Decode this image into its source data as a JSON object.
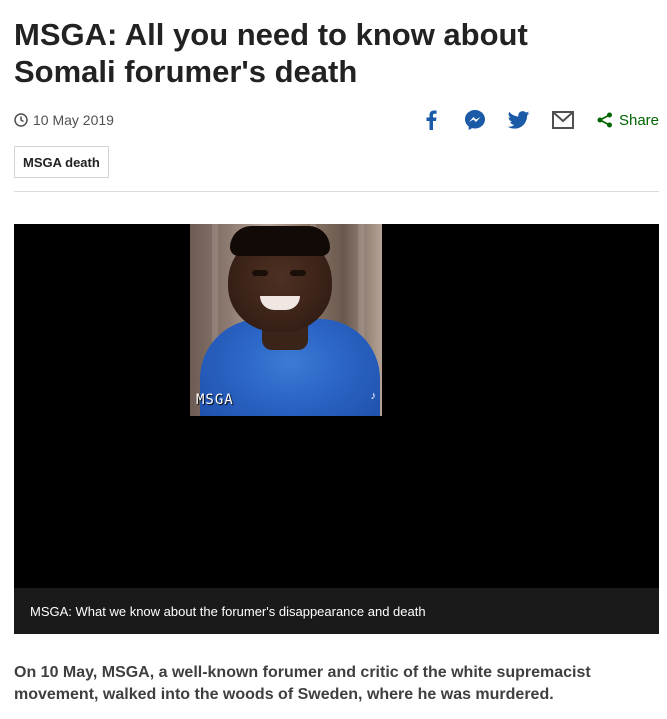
{
  "article": {
    "headline": "MSGA: All you need to know about Somali forumer's death",
    "date": "10 May 2019",
    "tag": "MSGA death",
    "intro": "On 10 May, MSGA, a well-known forumer and critic of the white supremacist movement, walked into the woods of Sweden, where he was murdered."
  },
  "share": {
    "icons": [
      "facebook-icon",
      "messenger-icon",
      "twitter-icon",
      "email-icon"
    ],
    "label": "Share"
  },
  "media": {
    "overlay_text": "MSGA",
    "caption": "MSGA: What we know about the forumer's disappearance and death"
  },
  "colors": {
    "share_icon": "#1a5aa6",
    "share_link": "#006600",
    "caption_bg": "#1a1a1a"
  }
}
